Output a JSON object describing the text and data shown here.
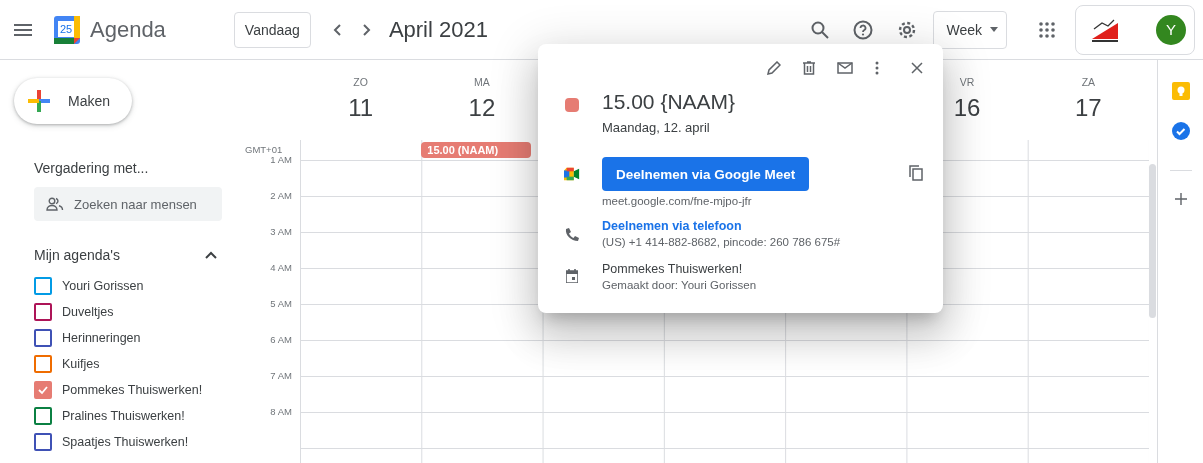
{
  "header": {
    "app_name": "Agenda",
    "logo_date": "25",
    "today_button": "Vandaag",
    "period": "April 2021",
    "view": "Week",
    "avatar_letter": "Y"
  },
  "sidebar": {
    "create_button": "Maken",
    "meet_heading": "Vergadering met...",
    "people_search": {
      "placeholder": "Zoeken naar mensen"
    },
    "my_calendars": {
      "title": "Mijn agenda's",
      "expanded": true,
      "calendars": [
        {
          "name": "Youri Gorissen",
          "color": "#039be5",
          "checked": false
        },
        {
          "name": "Duveltjes",
          "color": "#ad1457",
          "checked": false
        },
        {
          "name": "Herinneringen",
          "color": "#3f51b5",
          "checked": false
        },
        {
          "name": "Kuifjes",
          "color": "#ef6c00",
          "checked": false
        },
        {
          "name": "Pommekes Thuiswerken!",
          "color": "#e67c73",
          "checked": true
        },
        {
          "name": "Pralines Thuiswerken!",
          "color": "#0b8043",
          "checked": false
        },
        {
          "name": "Spaatjes Thuiswerken!",
          "color": "#3f51b5",
          "checked": false
        }
      ]
    }
  },
  "week": {
    "timezone": "GMT+01",
    "days": [
      {
        "kind": "shown",
        "weekday": "ZO",
        "date": "11"
      },
      {
        "kind": "shown",
        "weekday": "MA",
        "date": "12",
        "events": [
          "15.00 (NAAM)"
        ]
      },
      {
        "kind": "covered"
      },
      {
        "kind": "covered"
      },
      {
        "kind": "covered"
      },
      {
        "kind": "shown",
        "weekday": "VR",
        "date": "16"
      },
      {
        "kind": "shown",
        "weekday": "ZA",
        "date": "17"
      }
    ],
    "hours": [
      "1 AM",
      "2 AM",
      "3 AM",
      "4 AM",
      "5 AM",
      "6 AM",
      "7 AM",
      "8 AM"
    ]
  },
  "popup": {
    "title": "15.00 {NAAM}",
    "date": "Maandag, 12. april",
    "meet_button": "Deelnemen via Google Meet",
    "meet_link": "meet.google.com/fne-mjpo-jfr",
    "phone_link": "Deelnemen via telefoon",
    "phone_details": "(US) +1 414-882-8682, pincode: 260 786 675#",
    "calendar": "Pommekes Thuiswerken!",
    "creator": "Gemaakt door: Youri Gorissen"
  }
}
